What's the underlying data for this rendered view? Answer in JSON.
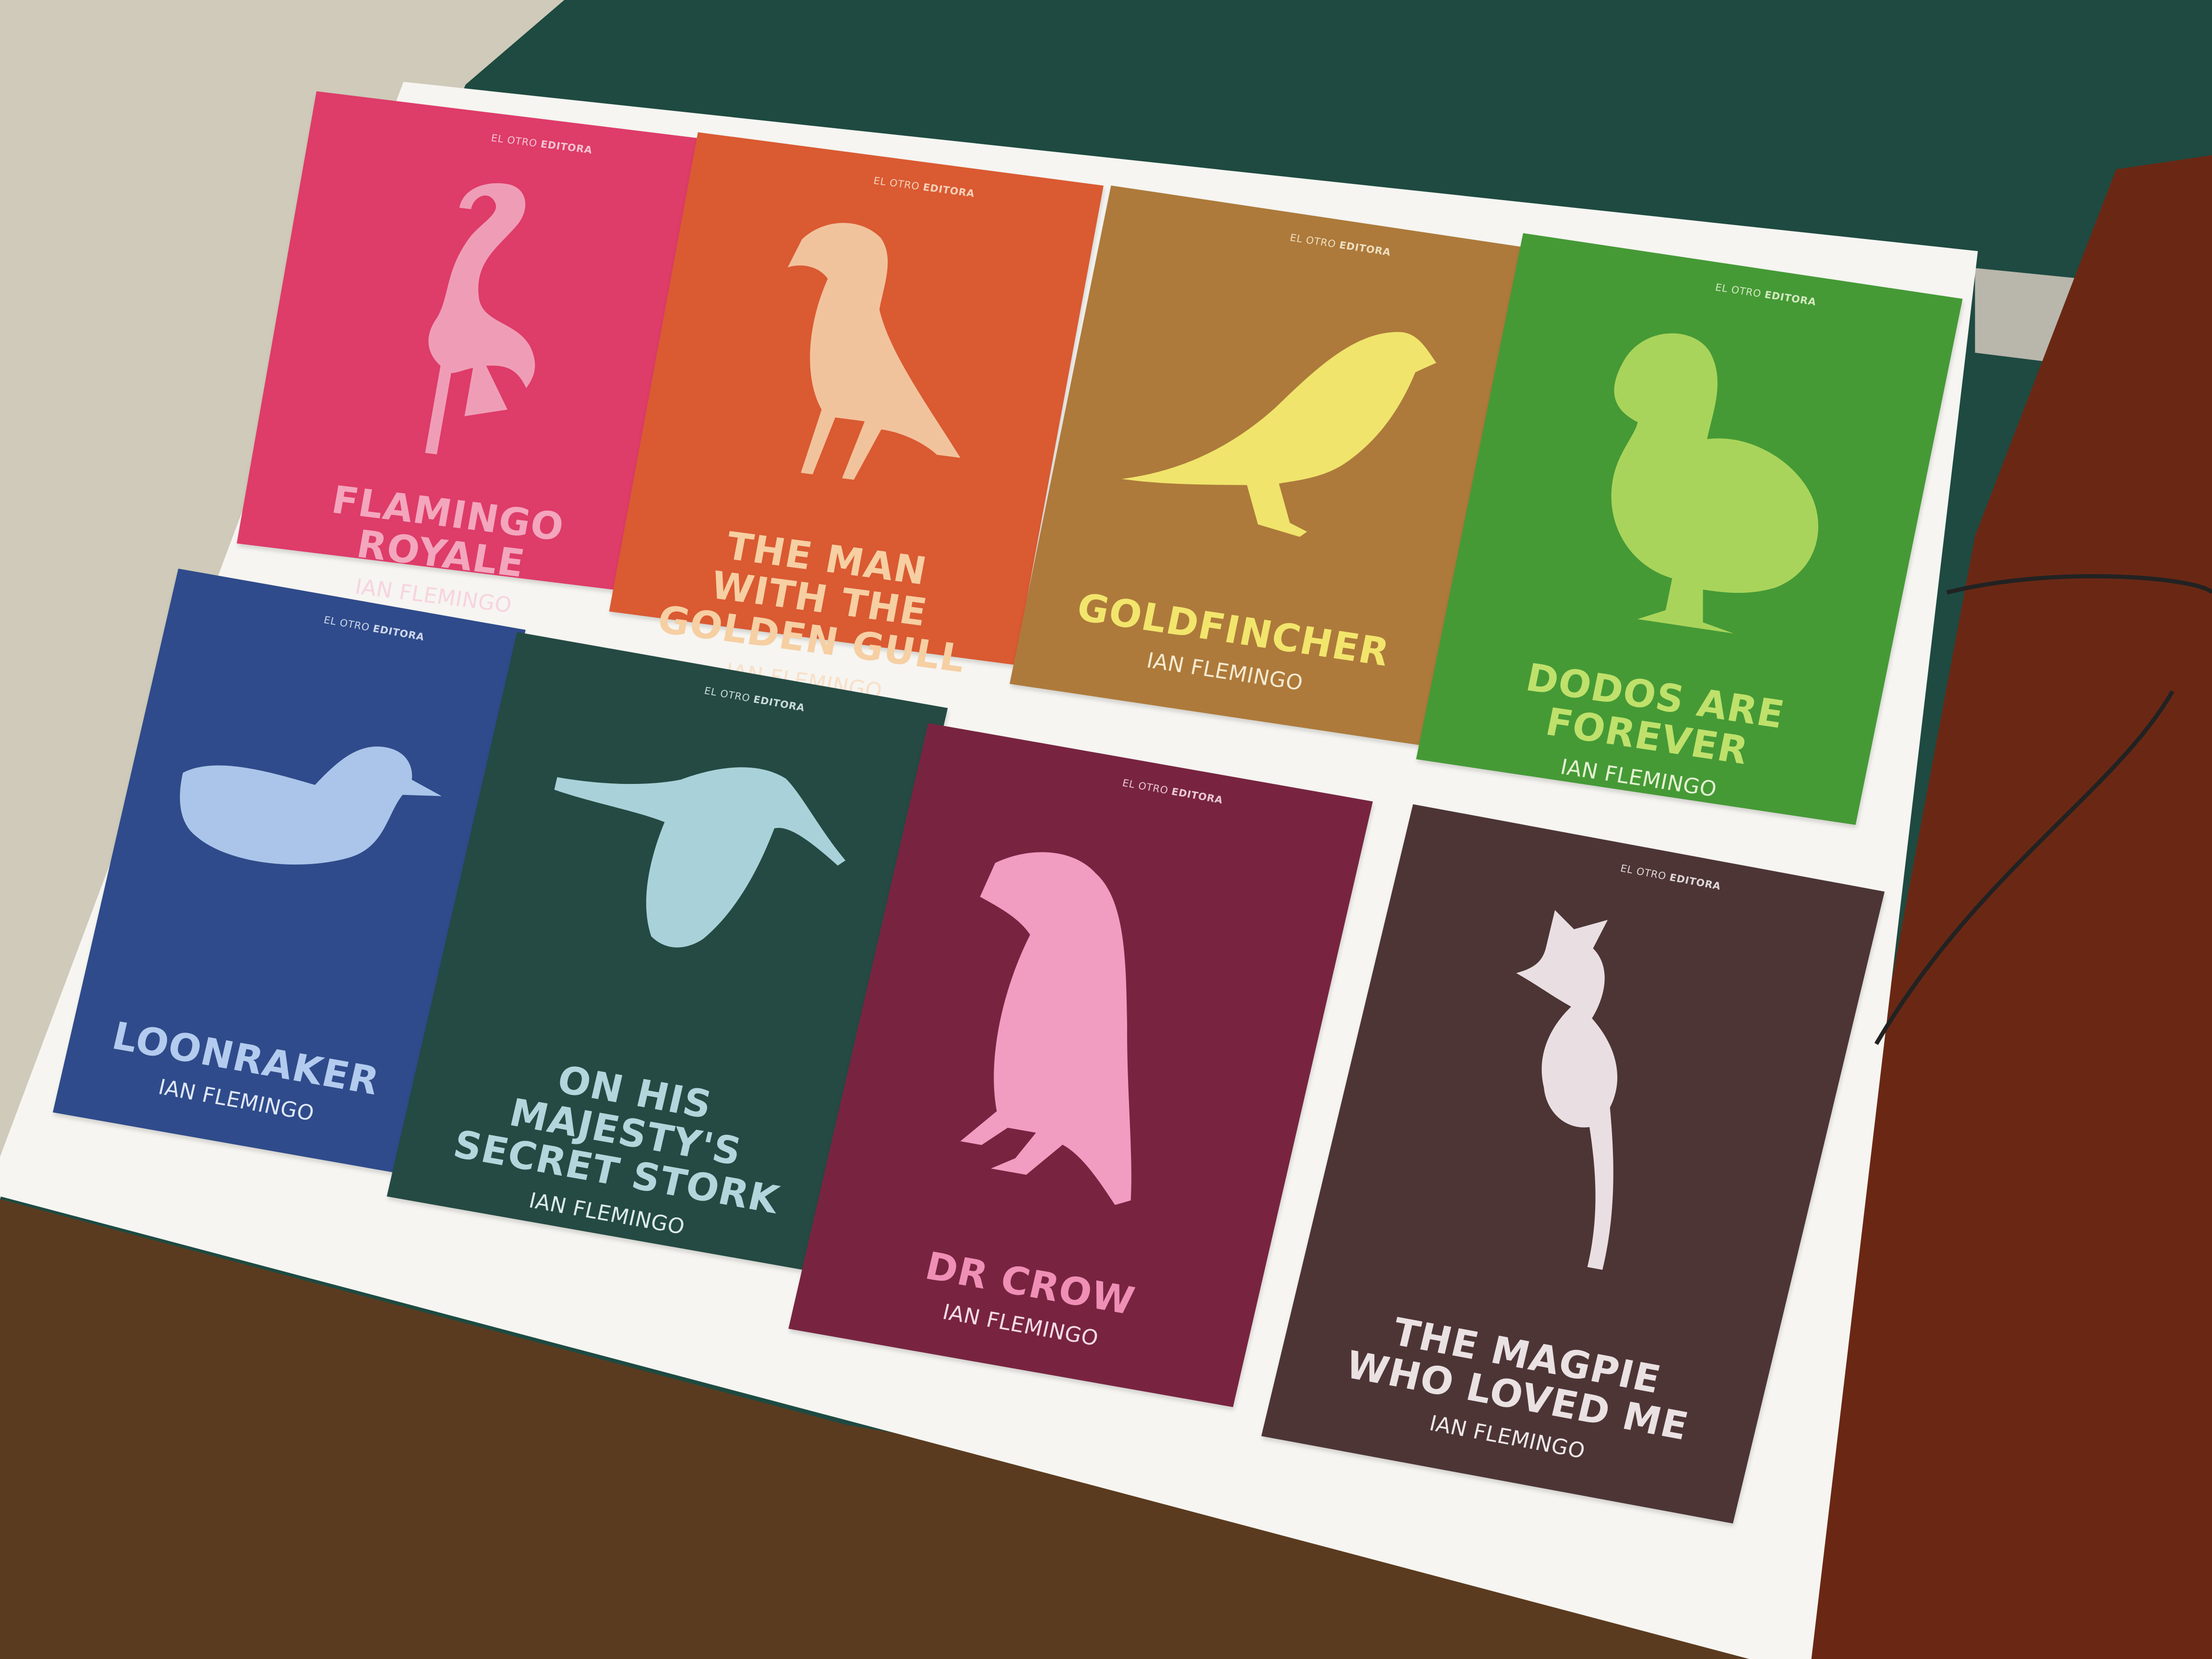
{
  "scene": {
    "colors": {
      "wall_top": "#1e4a41",
      "wall_left": "#cfcab9",
      "fabric": "#6a2814",
      "floor": "#5b3b1f",
      "board": "#f6f5f1"
    }
  },
  "cards": [
    {
      "publisher_a": "EL OTRO",
      "publisher_b": "EDITORA",
      "title_lines": [
        "FLAMINGO",
        "ROYALE"
      ],
      "author": "IAN FLEMINGO",
      "icon": "flamingo-icon",
      "bg": "#de3c69",
      "fg": "#ef9db7",
      "text": "#f3a6bd",
      "author_color": "#f7d4de"
    },
    {
      "publisher_a": "EL OTRO",
      "publisher_b": "EDITORA",
      "title_lines": [
        "THE MAN",
        "WITH THE",
        "GOLDEN GULL"
      ],
      "author": "IAN FLEMINGO",
      "icon": "gull-icon",
      "bg": "#da5a32",
      "fg": "#f1c39c",
      "text": "#f6cfa3",
      "author_color": "#f8e0c8"
    },
    {
      "publisher_a": "EL OTRO",
      "publisher_b": "EDITORA",
      "title_lines": [
        "GOLDFINCHER"
      ],
      "author": "IAN FLEMINGO",
      "icon": "goldfinch-icon",
      "bg": "#ad7a3b",
      "fg": "#f0e46c",
      "text": "#f2e56c",
      "author_color": "#f6ead0"
    },
    {
      "publisher_a": "EL OTRO",
      "publisher_b": "EDITORA",
      "title_lines": [
        "DODOS ARE",
        "FOREVER"
      ],
      "author": "IAN FLEMINGO",
      "icon": "dodo-icon",
      "bg": "#459a36",
      "fg": "#a9d45b",
      "text": "#bfe16b",
      "author_color": "#e6f2d2"
    },
    {
      "publisher_a": "EL OTRO",
      "publisher_b": "EDITORA",
      "title_lines": [
        "LOONRAKER"
      ],
      "author": "IAN FLEMINGO",
      "icon": "loon-icon",
      "bg": "#2f4b8b",
      "fg": "#aac5e9",
      "text": "#b3cbee",
      "author_color": "#dfe7f6"
    },
    {
      "publisher_a": "EL OTRO",
      "publisher_b": "EDITORA",
      "title_lines": [
        "ON HIS",
        "MAJESTY'S",
        "SECRET STORK"
      ],
      "author": "IAN FLEMINGO",
      "icon": "stork-icon",
      "bg": "#244a43",
      "fg": "#a9d1d9",
      "text": "#b2d6dc",
      "author_color": "#dceaea"
    },
    {
      "publisher_a": "EL OTRO",
      "publisher_b": "EDITORA",
      "title_lines": [
        "DR CROW"
      ],
      "author": "IAN FLEMINGO",
      "icon": "crow-icon",
      "bg": "#782441",
      "fg": "#f19cc1",
      "text": "#ef8fb6",
      "author_color": "#f5dbe5"
    },
    {
      "publisher_a": "EL OTRO",
      "publisher_b": "EDITORA",
      "title_lines": [
        "THE MAGPIE",
        "WHO LOVED ME"
      ],
      "author": "IAN FLEMINGO",
      "icon": "magpie-icon",
      "bg": "#4d3536",
      "fg": "#e9dfe2",
      "text": "#eae1e3",
      "author_color": "#efe8ea"
    }
  ]
}
